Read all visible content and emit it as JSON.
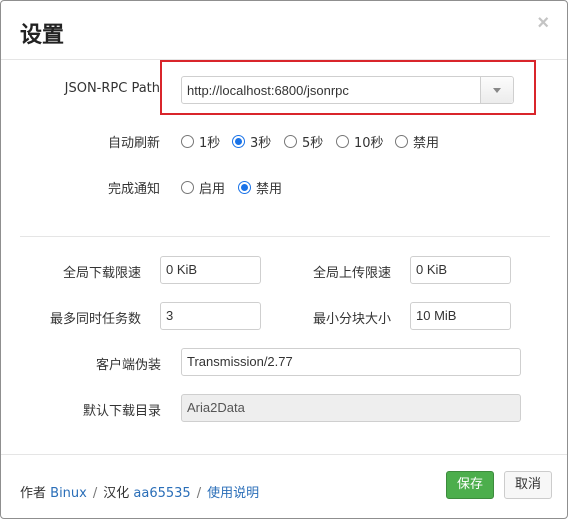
{
  "dialog": {
    "title": "设置",
    "close_symbol": "×"
  },
  "rpc": {
    "label": "JSON-RPC Path",
    "value": "http://localhost:6800/jsonrpc"
  },
  "auto_refresh": {
    "label": "自动刷新",
    "options": [
      "1秒",
      "3秒",
      "5秒",
      "10秒",
      "禁用"
    ],
    "selected": "3秒"
  },
  "notify": {
    "label": "完成通知",
    "options": [
      "启用",
      "禁用"
    ],
    "selected": "禁用"
  },
  "limits": {
    "download_label": "全局下载限速",
    "download_value": "0 KiB",
    "upload_label": "全局上传限速",
    "upload_value": "0 KiB",
    "tasks_label": "最多同时任务数",
    "tasks_value": "3",
    "split_label": "最小分块大小",
    "split_value": "10 MiB"
  },
  "client": {
    "label": "客户端伪装",
    "value": "Transmission/2.77"
  },
  "dir": {
    "label": "默认下载目录",
    "value": "Aria2Data"
  },
  "footer": {
    "author_prefix": "作者",
    "author": "Binux",
    "sep": "/",
    "trans_prefix": "汉化",
    "translator": "aa65535",
    "help": "使用说明"
  },
  "buttons": {
    "save": "保存",
    "cancel": "取消"
  },
  "colors": {
    "highlight": "#d9252b",
    "save": "#4cae4c",
    "link": "#2a6eb8",
    "radio": "#1a73e8"
  }
}
